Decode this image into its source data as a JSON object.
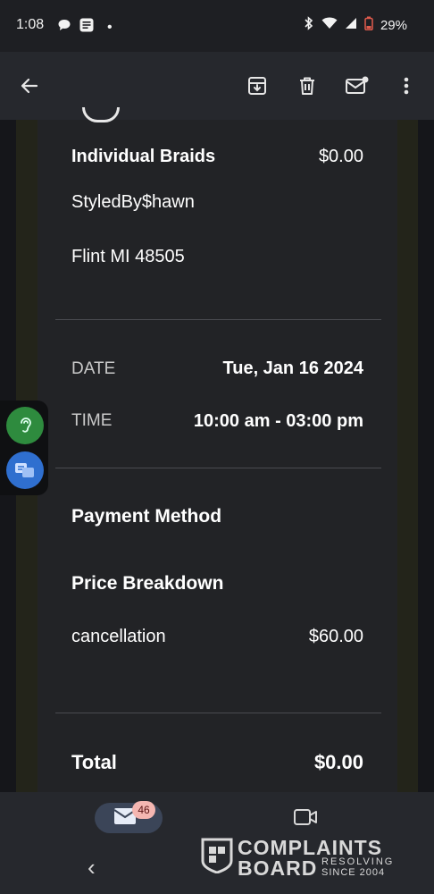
{
  "status_bar": {
    "time": "1:08",
    "dot": "•",
    "battery": "29%"
  },
  "app_bar": {
    "icons": [
      "back-arrow-icon",
      "archive-icon",
      "trash-icon",
      "mark-unread-icon",
      "more-vert-icon"
    ]
  },
  "email": {
    "service_name": "Individual Braids",
    "service_price": "$0.00",
    "business_name": "StyledBy$hawn",
    "location": "Flint MI 48505",
    "date_label": "DATE",
    "date_value": "Tue, Jan 16 2024",
    "time_label": "TIME",
    "time_value": "10:00 am - 03:00 pm",
    "payment_method_heading": "Payment Method",
    "price_breakdown_heading": "Price Breakdown",
    "breakdown_item": "cancellation",
    "breakdown_amount": "$60.00",
    "total_label": "Total",
    "total_value": "$0.00"
  },
  "bottom_nav": {
    "mail_badge": "46",
    "back_glyph": "‹"
  },
  "watermark": {
    "line1": "COMPLAINTS",
    "line2": "BOARD",
    "tag1": "RESOLVING",
    "tag2": "SINCE 2004"
  },
  "colors": {
    "background": "#1e1f23",
    "card": "#222326",
    "accent_pill": "#3b4558",
    "badge": "#f4b6b1"
  }
}
